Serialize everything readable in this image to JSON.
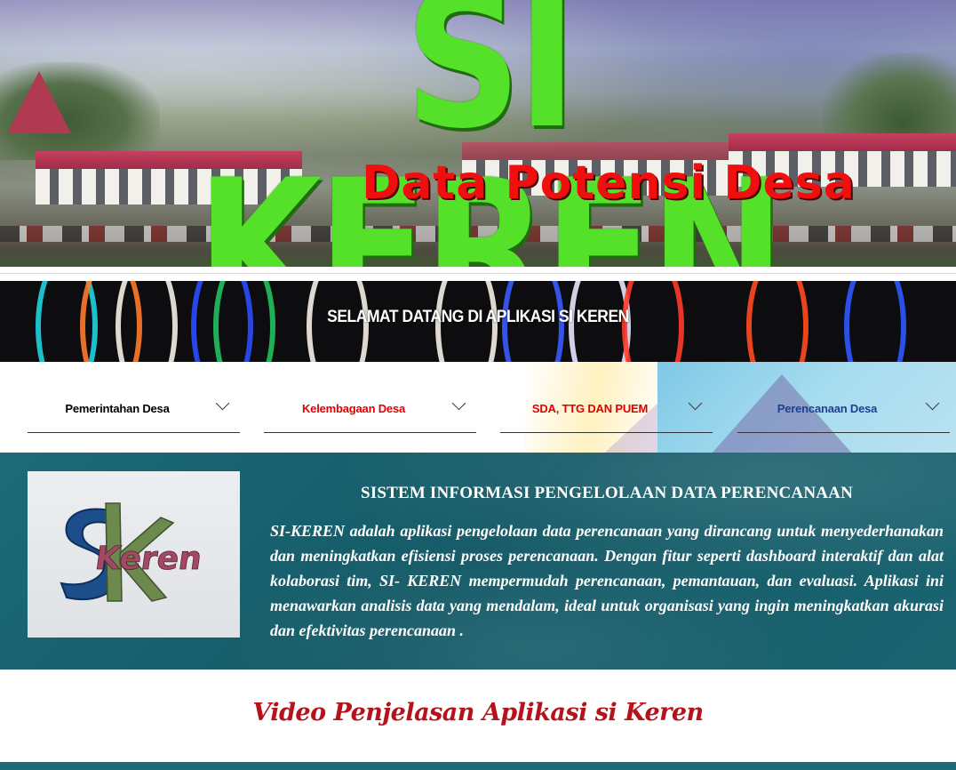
{
  "hero": {
    "title": "SI KEREN",
    "subtitle": "Data Potensi Desa"
  },
  "welcome": {
    "text": "SELAMAT DATANG DI APLIKASI SI KEREN"
  },
  "menu": {
    "items": [
      {
        "label": "Pemerintahan Desa",
        "color": "#000000"
      },
      {
        "label": "Kelembagaan Desa",
        "color": "#e00000"
      },
      {
        "label": "SDA, TTG DAN PUEM",
        "color": "#e00000"
      },
      {
        "label": "Perencanaan Desa",
        "color": "#1f3f8f"
      }
    ]
  },
  "info": {
    "logo_text": "Keren",
    "title": "SISTEM INFORMASI PENGELOLAAN DATA PERENCANAAN",
    "body": "SI-KEREN adalah aplikasi pengelolaan data perencanaan yang dirancang untuk menyederhanakan dan meningkatkan efisiensi proses perencanaan. Dengan fitur seperti dashboard interaktif dan alat kolaborasi tim, SI- KEREN mempermudah perencanaan, pemantauan, dan evaluasi.  Aplikasi ini menawarkan analisis data yang mendalam, ideal untuk organisasi yang ingin meningkatkan akurasi dan efektivitas perencanaan ."
  },
  "video": {
    "title": "Video Penjelasan Aplikasi si Keren"
  },
  "colors": {
    "hero_title": "#55e02a",
    "hero_subtitle": "#f00e0e",
    "info_bg": "#1c6a78",
    "video_title": "#b5121b"
  }
}
